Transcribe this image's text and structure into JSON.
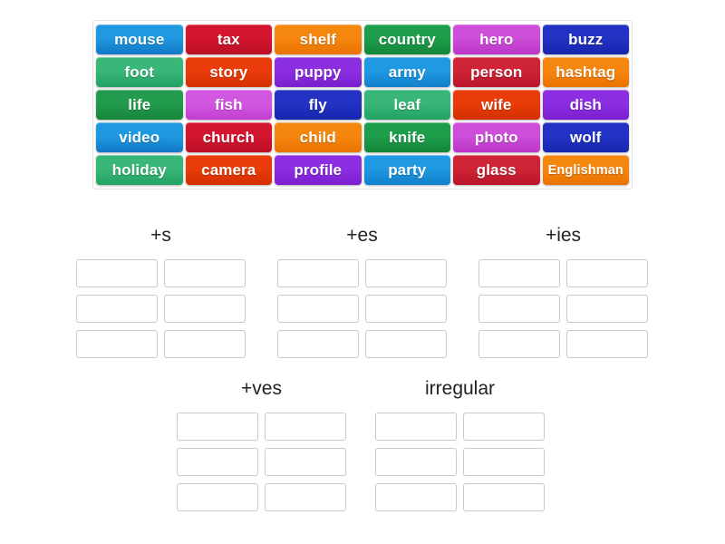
{
  "activity": {
    "type": "group-sort",
    "word_bank": {
      "name": "word-bank",
      "rows": [
        [
          {
            "text": "mouse",
            "color": "#1f99e0",
            "color2": "#1278c6"
          },
          {
            "text": "tax",
            "color": "#d3152f",
            "color2": "#bc0f27"
          },
          {
            "text": "shelf",
            "color": "#f5870f",
            "color2": "#ea7200"
          },
          {
            "text": "country",
            "color": "#1e9e4a",
            "color2": "#14853a"
          },
          {
            "text": "hero",
            "color": "#cd4ed8",
            "color2": "#bb35c8"
          },
          {
            "text": "buzz",
            "color": "#2233c4",
            "color2": "#1726ad"
          }
        ],
        [
          {
            "text": "foot",
            "color": "#38b778",
            "color2": "#23a265"
          },
          {
            "text": "story",
            "color": "#ea3c0a",
            "color2": "#d42f00"
          },
          {
            "text": "puppy",
            "color": "#8b2fe0",
            "color2": "#7a1ed0"
          },
          {
            "text": "army",
            "color": "#2099e3",
            "color2": "#1180ca"
          },
          {
            "text": "person",
            "color": "#cf2436",
            "color2": "#b9152a"
          },
          {
            "text": "hashtag",
            "color": "#f5870f",
            "color2": "#ea7200"
          }
        ],
        [
          {
            "text": "life",
            "color": "#229b4e",
            "color2": "#17853d"
          },
          {
            "text": "fish",
            "color": "#d257e0",
            "color2": "#c23ed1"
          },
          {
            "text": "fly",
            "color": "#2233c4",
            "color2": "#1726ad"
          },
          {
            "text": "leaf",
            "color": "#38b778",
            "color2": "#23a265"
          },
          {
            "text": "wife",
            "color": "#ea3c0a",
            "color2": "#d42f00"
          },
          {
            "text": "dish",
            "color": "#8b2fe0",
            "color2": "#7a1ed0"
          }
        ],
        [
          {
            "text": "video",
            "color": "#1f99e0",
            "color2": "#1278c6"
          },
          {
            "text": "church",
            "color": "#d3152f",
            "color2": "#bc0f27"
          },
          {
            "text": "child",
            "color": "#f5870f",
            "color2": "#ea7200"
          },
          {
            "text": "knife",
            "color": "#1e9e4a",
            "color2": "#14853a"
          },
          {
            "text": "photo",
            "color": "#cd4ed8",
            "color2": "#bb35c8"
          },
          {
            "text": "wolf",
            "color": "#2233c4",
            "color2": "#1726ad"
          }
        ],
        [
          {
            "text": "holiday",
            "color": "#38b778",
            "color2": "#23a265"
          },
          {
            "text": "camera",
            "color": "#ea3c0a",
            "color2": "#d42f00"
          },
          {
            "text": "profile",
            "color": "#8b2fe0",
            "color2": "#7a1ed0"
          },
          {
            "text": "party",
            "color": "#2099e3",
            "color2": "#1180ca"
          },
          {
            "text": "glass",
            "color": "#cf2436",
            "color2": "#b9152a"
          },
          {
            "text": "Englishman",
            "color": "#f5870f",
            "color2": "#ea7200",
            "small": true
          }
        ]
      ]
    },
    "groups": [
      {
        "label": "+s",
        "slots": 6
      },
      {
        "label": "+es",
        "slots": 6
      },
      {
        "label": "+ies",
        "slots": 6
      },
      {
        "label": "+ves",
        "slots": 6
      },
      {
        "label": "irregular",
        "slots": 6
      }
    ]
  }
}
